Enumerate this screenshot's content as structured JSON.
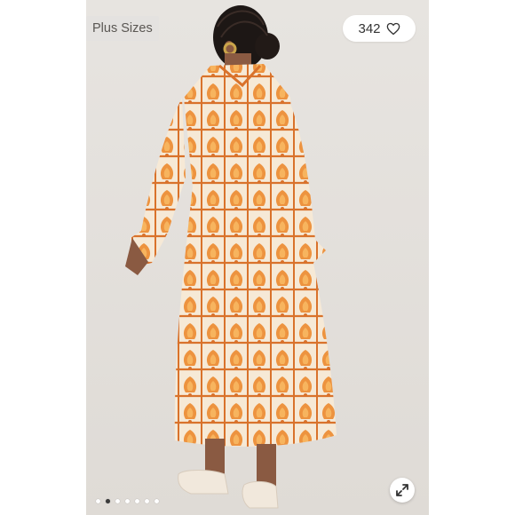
{
  "listing": {
    "tag_label": "Plus Sizes",
    "like_count": "342",
    "like_icon": "heart-outline-icon",
    "expand_icon": "expand-arrows-icon"
  },
  "carousel": {
    "total_images": 7,
    "current_index": 1
  },
  "colors": {
    "photo_background": "#e6e3df",
    "dress_orange": "#e98a35",
    "dress_cream": "#f6e9d6",
    "skin": "#8a5a42",
    "hair": "#1d1715"
  }
}
